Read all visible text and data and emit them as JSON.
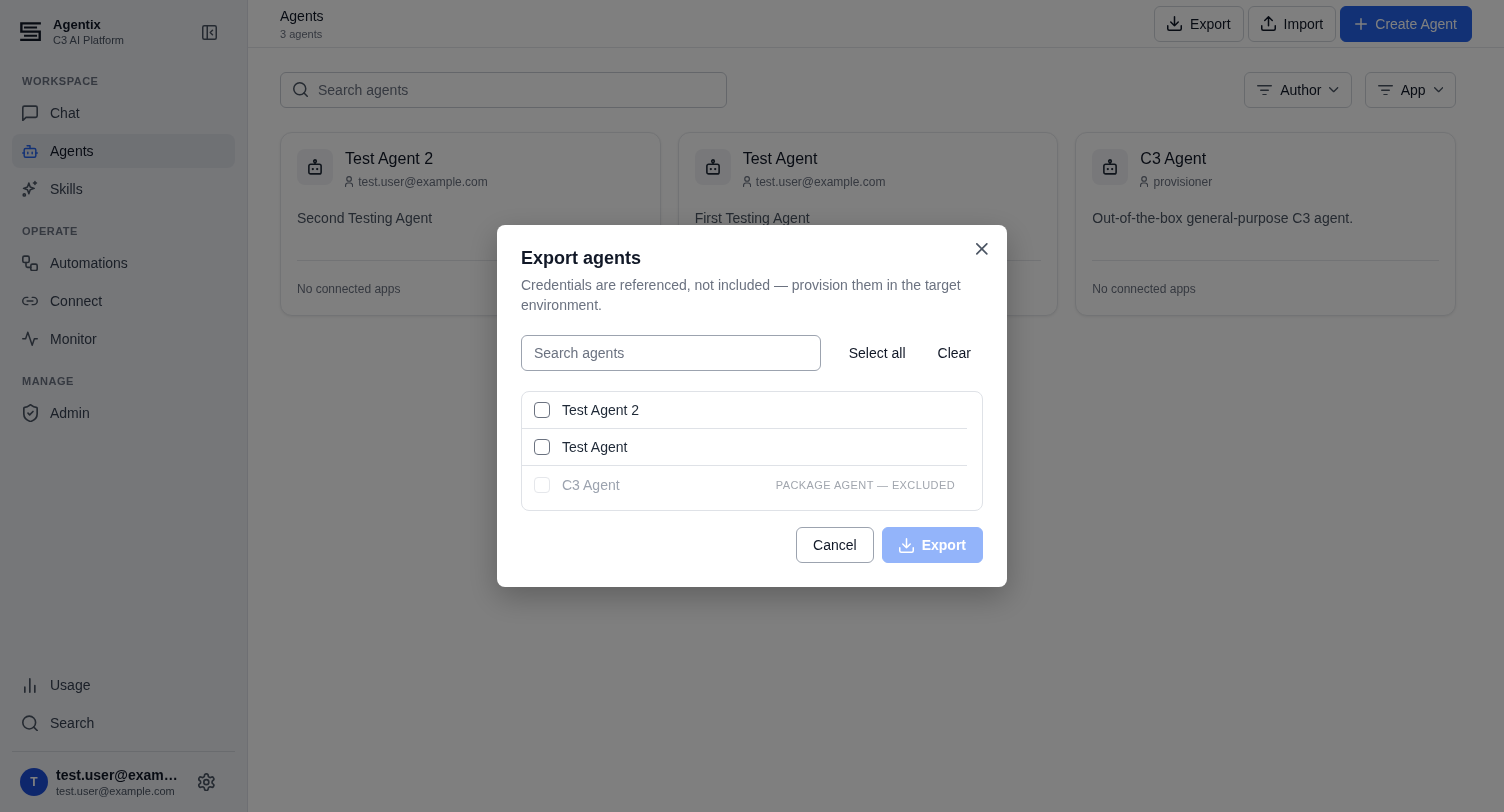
{
  "sidebar": {
    "brand": {
      "name": "Agentix",
      "subtitle": "C3 AI Platform"
    },
    "sections": [
      {
        "label": "WORKSPACE",
        "items": [
          {
            "label": "Chat",
            "selected": false
          },
          {
            "label": "Agents",
            "selected": true
          },
          {
            "label": "Skills",
            "selected": false
          }
        ]
      },
      {
        "label": "OPERATE",
        "items": [
          {
            "label": "Automations",
            "selected": false
          },
          {
            "label": "Connect",
            "selected": false
          },
          {
            "label": "Monitor",
            "selected": false
          }
        ]
      },
      {
        "label": "MANAGE",
        "items": [
          {
            "label": "Admin",
            "selected": false
          }
        ]
      }
    ],
    "bottom_items": [
      {
        "label": "Usage",
        "selected": false
      },
      {
        "label": "Search",
        "selected": false
      }
    ],
    "user": {
      "initial": "T",
      "name": "test.user@exam…",
      "email": "test.user@example.com"
    }
  },
  "header": {
    "title": "Agents",
    "subtitle": "3 agents",
    "buttons": [
      {
        "label": "Export",
        "kind": "outline"
      },
      {
        "label": "Import",
        "kind": "outline"
      },
      {
        "label": "Create Agent",
        "kind": "primary"
      }
    ]
  },
  "toolbar": {
    "search": {
      "placeholder": "Search agents"
    },
    "filters": [
      {
        "label": "Author"
      },
      {
        "label": "App"
      }
    ]
  },
  "cards": [
    {
      "name": "Test Agent 2",
      "author": "test.user@example.com",
      "description": "Second Testing Agent",
      "apps": "No connected apps"
    },
    {
      "name": "Test Agent",
      "author": "test.user@example.com",
      "description": "First Testing Agent"
    },
    {
      "name": "C3 Agent",
      "author": "provisioner",
      "description": "Out-of-the-box general-purpose C3 agent.",
      "apps": "No connected apps"
    }
  ],
  "dialog": {
    "title": "Export agents",
    "description": "Credentials are referenced, not included — provision them in the target environment.",
    "search": {
      "placeholder": "Search agents"
    },
    "actions": [
      {
        "label": "Select all"
      },
      {
        "label": "Clear"
      }
    ],
    "agents": [
      {
        "name": "Test Agent 2",
        "checked": false,
        "disabled": false
      },
      {
        "name": "Test Agent",
        "checked": false,
        "disabled": false
      },
      {
        "name": "C3 Agent",
        "checked": false,
        "disabled": true,
        "note": "PACKAGE AGENT — EXCLUDED"
      }
    ],
    "buttons": [
      {
        "label": "Cancel",
        "kind": "secondary",
        "disabled": false
      },
      {
        "label": "Export",
        "kind": "primary",
        "disabled": true
      }
    ]
  }
}
